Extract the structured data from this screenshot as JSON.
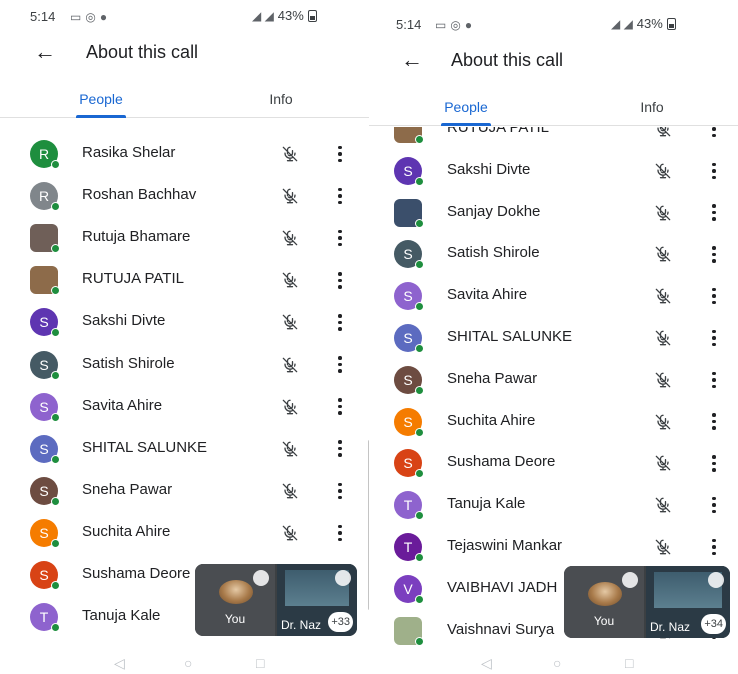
{
  "screens": [
    {
      "status": {
        "time": "5:14",
        "battery": "43%"
      },
      "header": {
        "title": "About this call"
      },
      "tabs": [
        {
          "label": "People",
          "active": true
        },
        {
          "label": "Info",
          "active": false
        }
      ],
      "participants": [
        {
          "name": "Rasika Shelar",
          "initial": "R",
          "color": "#1e8e3e",
          "photo": false
        },
        {
          "name": "Roshan Bachhav",
          "initial": "R",
          "color": "#80868b",
          "photo": false
        },
        {
          "name": "Rutuja Bhamare",
          "initial": "",
          "color": "#6f5f58",
          "photo": true
        },
        {
          "name": "RUTUJA PATIL",
          "initial": "",
          "color": "#8d6b4a",
          "photo": true
        },
        {
          "name": "Sakshi Divte",
          "initial": "S",
          "color": "#5e35b1",
          "photo": false
        },
        {
          "name": "Satish Shirole",
          "initial": "S",
          "color": "#455a64",
          "photo": false
        },
        {
          "name": "Savita Ahire",
          "initial": "S",
          "color": "#8e63ce",
          "photo": false
        },
        {
          "name": "SHITAL SALUNKE",
          "initial": "S",
          "color": "#5c6bc0",
          "photo": false
        },
        {
          "name": "Sneha Pawar",
          "initial": "S",
          "color": "#6d4c41",
          "photo": false
        },
        {
          "name": "Suchita Ahire",
          "initial": "S",
          "color": "#f57c00",
          "photo": false
        },
        {
          "name": "Sushama Deore",
          "initial": "S",
          "color": "#d84315",
          "photo": false
        },
        {
          "name": "Tanuja Kale",
          "initial": "T",
          "color": "#8e63ce",
          "photo": false
        }
      ],
      "pip": {
        "self_label": "You",
        "speaker_label": "Dr. Naz",
        "extra_count": "+33"
      }
    },
    {
      "status": {
        "time": "5:14",
        "battery": "43%"
      },
      "header": {
        "title": "About this call"
      },
      "tabs": [
        {
          "label": "People",
          "active": true
        },
        {
          "label": "Info",
          "active": false
        }
      ],
      "participants": [
        {
          "name": "RUTUJA PATIL",
          "initial": "",
          "color": "#8d6b4a",
          "photo": true
        },
        {
          "name": "Sakshi Divte",
          "initial": "S",
          "color": "#5e35b1",
          "photo": false
        },
        {
          "name": "Sanjay Dokhe",
          "initial": "",
          "color": "#3b4f6b",
          "photo": true
        },
        {
          "name": "Satish Shirole",
          "initial": "S",
          "color": "#455a64",
          "photo": false
        },
        {
          "name": "Savita Ahire",
          "initial": "S",
          "color": "#8e63ce",
          "photo": false
        },
        {
          "name": "SHITAL SALUNKE",
          "initial": "S",
          "color": "#5c6bc0",
          "photo": false
        },
        {
          "name": "Sneha Pawar",
          "initial": "S",
          "color": "#6d4c41",
          "photo": false
        },
        {
          "name": "Suchita Ahire",
          "initial": "S",
          "color": "#f57c00",
          "photo": false
        },
        {
          "name": "Sushama Deore",
          "initial": "S",
          "color": "#d84315",
          "photo": false
        },
        {
          "name": "Tanuja Kale",
          "initial": "T",
          "color": "#8e63ce",
          "photo": false
        },
        {
          "name": "Tejaswini Mankar",
          "initial": "T",
          "color": "#6a1b9a",
          "photo": false
        },
        {
          "name": "VAIBHAVI JADH",
          "initial": "V",
          "color": "#7b3fbf",
          "photo": false
        },
        {
          "name": "Vaishnavi Surya",
          "initial": "",
          "color": "#9fb08a",
          "photo": true
        }
      ],
      "pip": {
        "self_label": "You",
        "speaker_label": "Dr. Naz",
        "extra_count": "+34"
      }
    }
  ]
}
